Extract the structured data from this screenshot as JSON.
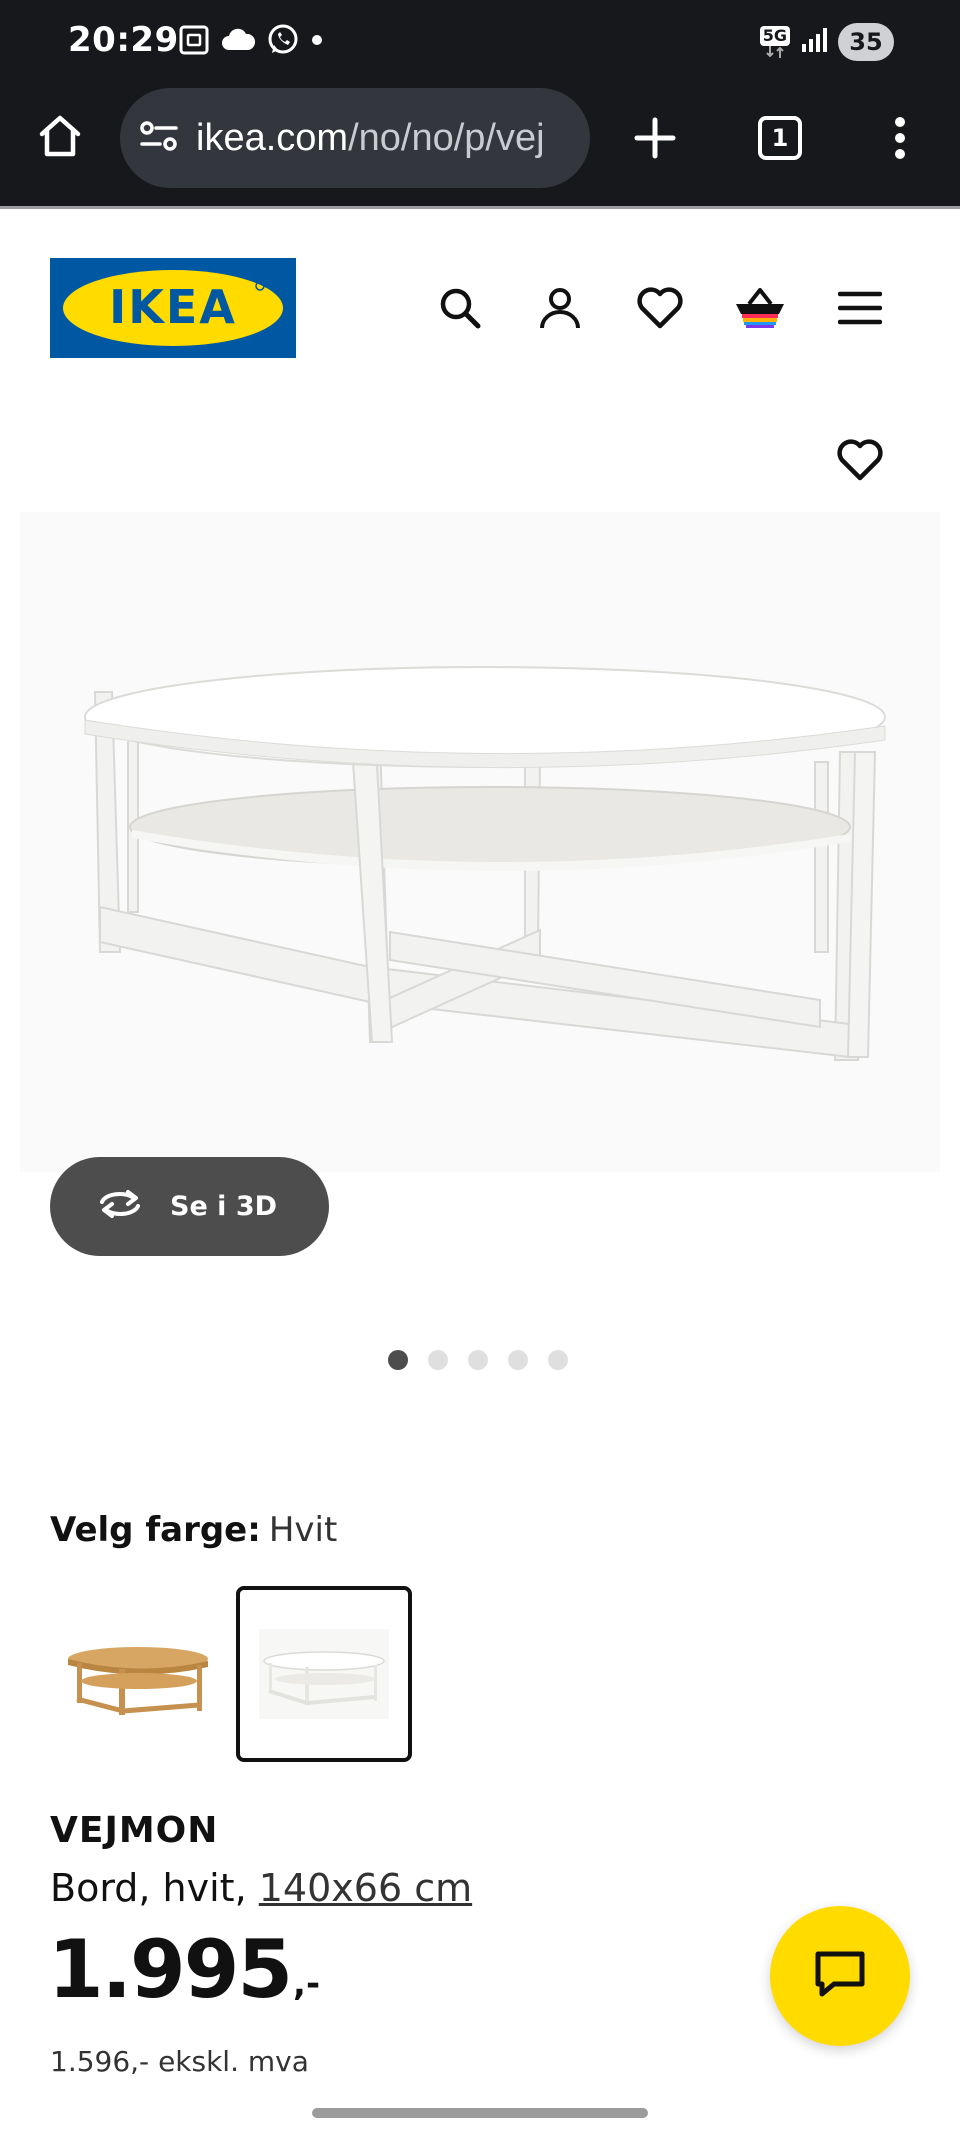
{
  "status_bar": {
    "time": "20:29",
    "network": "5G",
    "battery": "35",
    "icons": [
      "screenshot-icon",
      "cloud-icon",
      "whatsapp-icon",
      "dot-icon",
      "signal-icon"
    ]
  },
  "browser": {
    "url_domain": "ikea.com",
    "url_path": "/no/no/p/vej",
    "tab_count": "1",
    "icons": [
      "home-icon",
      "site-settings-icon",
      "new-tab-icon",
      "tabs-icon",
      "more-icon"
    ]
  },
  "header": {
    "logo_text": "IKEA",
    "nav_icons": [
      "search-icon",
      "profile-icon",
      "wishlist-icon",
      "cart-icon",
      "menu-icon"
    ]
  },
  "gallery": {
    "view_3d_label": "Se i 3D",
    "dots_count": 5,
    "active_dot_index": 0
  },
  "color": {
    "label": "Velg farge:",
    "value": "Hvit",
    "swatches": [
      "oak-swatch",
      "white-swatch"
    ],
    "selected_index": 1
  },
  "product": {
    "name": "VEJMON",
    "description": "Bord, hvit, ",
    "size": "140x66 cm",
    "price_integer": "1.995",
    "price_suffix": ",-",
    "price_excl_vat": "1.596,- ekskl. mva"
  },
  "colors": {
    "status_bar_bg": "#16181c",
    "url_bar_bg": "#33363c",
    "ikea_blue": "#0058a3",
    "ikea_yellow": "#ffdb00",
    "button_dark": "#4d4d4d"
  }
}
